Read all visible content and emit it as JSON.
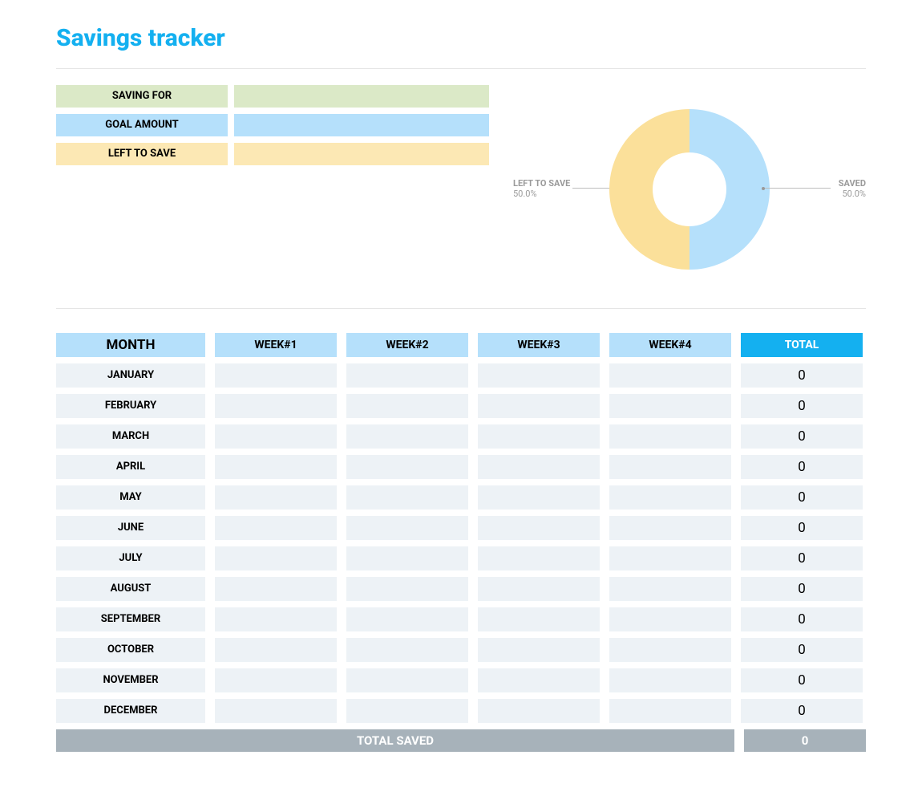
{
  "title": "Savings tracker",
  "goals": {
    "saving_for": {
      "label": "SAVING FOR",
      "value": "",
      "color": "g-green"
    },
    "goal_amount": {
      "label": "GOAL AMOUNT",
      "value": "",
      "color": "g-blue"
    },
    "left_to_save": {
      "label": "LEFT TO SAVE",
      "value": "",
      "color": "g-yellow"
    }
  },
  "chart_data": {
    "type": "pie",
    "title": "",
    "series": [
      {
        "name": "LEFT TO SAVE",
        "value": 50.0,
        "color": "#fbe09a"
      },
      {
        "name": "SAVED",
        "value": 50.0,
        "color": "#b5e0fb"
      }
    ],
    "labels": {
      "left": {
        "name": "LEFT TO SAVE",
        "pct": "50.0%"
      },
      "right": {
        "name": "SAVED",
        "pct": "50.0%"
      }
    }
  },
  "table": {
    "headers": {
      "month": "MONTH",
      "weeks": [
        "WEEK#1",
        "WEEK#2",
        "WEEK#3",
        "WEEK#4"
      ],
      "total": "TOTAL"
    },
    "rows": [
      {
        "month": "JANUARY",
        "weeks": [
          "",
          "",
          "",
          ""
        ],
        "total": "0"
      },
      {
        "month": "FEBRUARY",
        "weeks": [
          "",
          "",
          "",
          ""
        ],
        "total": "0"
      },
      {
        "month": "MARCH",
        "weeks": [
          "",
          "",
          "",
          ""
        ],
        "total": "0"
      },
      {
        "month": "APRIL",
        "weeks": [
          "",
          "",
          "",
          ""
        ],
        "total": "0"
      },
      {
        "month": "MAY",
        "weeks": [
          "",
          "",
          "",
          ""
        ],
        "total": "0"
      },
      {
        "month": "JUNE",
        "weeks": [
          "",
          "",
          "",
          ""
        ],
        "total": "0"
      },
      {
        "month": "JULY",
        "weeks": [
          "",
          "",
          "",
          ""
        ],
        "total": "0"
      },
      {
        "month": "AUGUST",
        "weeks": [
          "",
          "",
          "",
          ""
        ],
        "total": "0"
      },
      {
        "month": "SEPTEMBER",
        "weeks": [
          "",
          "",
          "",
          ""
        ],
        "total": "0"
      },
      {
        "month": "OCTOBER",
        "weeks": [
          "",
          "",
          "",
          ""
        ],
        "total": "0"
      },
      {
        "month": "NOVEMBER",
        "weeks": [
          "",
          "",
          "",
          ""
        ],
        "total": "0"
      },
      {
        "month": "DECEMBER",
        "weeks": [
          "",
          "",
          "",
          ""
        ],
        "total": "0"
      }
    ],
    "footer": {
      "label": "TOTAL SAVED",
      "total": "0"
    }
  }
}
